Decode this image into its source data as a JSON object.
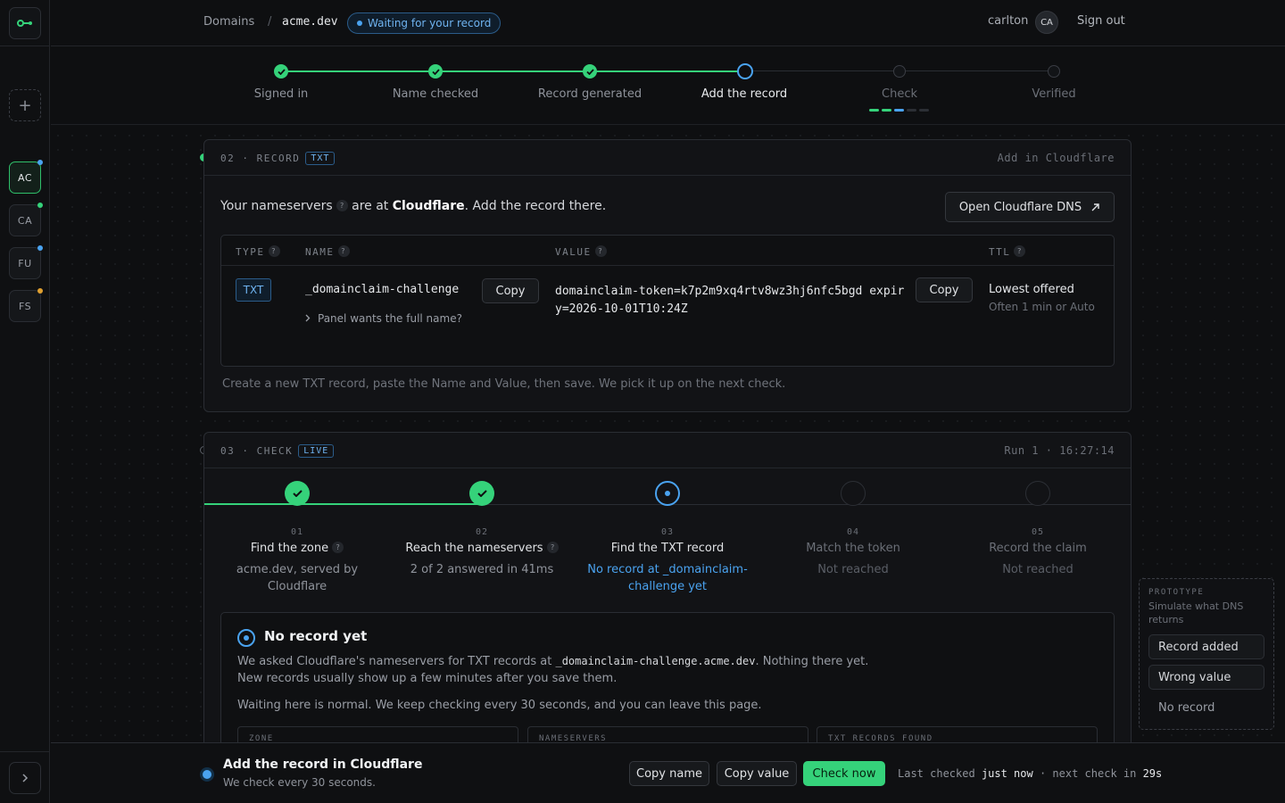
{
  "rail": {
    "workspaces": [
      {
        "label": "AC",
        "dot_color": "#4aa3f0"
      },
      {
        "label": "CA",
        "dot_color": "#35d27a"
      },
      {
        "label": "FU",
        "dot_color": "#4aa3f0"
      },
      {
        "label": "FS",
        "dot_color": "#e0a030"
      }
    ],
    "add_label": "+"
  },
  "header": {
    "crumb_root": "Domains",
    "crumb_sep": "/",
    "crumb_domain": "acme.dev",
    "status_badge": "Waiting for your record",
    "username": "carlton",
    "avatar": "CA",
    "signout": "Sign out"
  },
  "steps": [
    {
      "label": "Signed in",
      "state": "done"
    },
    {
      "label": "Name checked",
      "state": "done"
    },
    {
      "label": "Record generated",
      "state": "done"
    },
    {
      "label": "Add the record",
      "state": "current"
    },
    {
      "label": "Check",
      "state": "todo"
    },
    {
      "label": "Verified",
      "state": "todo"
    }
  ],
  "record": {
    "step_num": "02",
    "step_sep": "·",
    "step_name": "RECORD",
    "tag": "TXT",
    "right": "Add in Cloudflare",
    "intro_pre": "Your nameservers",
    "intro_mid": "are at",
    "intro_provider": "Cloudflare",
    "intro_post": ". Add the record there.",
    "open_dns_button": "Open Cloudflare DNS",
    "qm": "?",
    "columns": {
      "type": "TYPE",
      "name": "NAME",
      "value": "VALUE",
      "ttl": "TTL"
    },
    "type": "TXT",
    "name": "_domainclaim-challenge",
    "name_hint": "Panel wants the full name?",
    "value_line1": "domainclaim-token=k7p2m9xq4rtv8wz3hj6nfc5bgd expir",
    "value_line2": "y=2026-10-01T10:24Z",
    "copy": "Copy",
    "ttl_main": "Lowest offered",
    "ttl_sub": "Often 1 min or Auto",
    "footnote": "Create a new TXT record, paste the Name and Value, then save. We pick it up on the next check."
  },
  "check": {
    "step_num": "03",
    "step_sep": "·",
    "step_name": "CHECK",
    "tag": "LIVE",
    "run": "Run 1 · 16:27:14",
    "phases": [
      {
        "num": "01",
        "title": "Find the zone",
        "has_help": true,
        "sub": "acme.dev, served by Cloudflare",
        "state": "done"
      },
      {
        "num": "02",
        "title": "Reach the nameservers",
        "has_help": true,
        "sub": "2 of 2 answered in 41ms",
        "state": "done"
      },
      {
        "num": "03",
        "title": "Find the TXT record",
        "has_help": false,
        "sub": "No record at _domainclaim-challenge yet",
        "state": "current"
      },
      {
        "num": "04",
        "title": "Match the token",
        "has_help": false,
        "sub": "Not reached",
        "state": "todo"
      },
      {
        "num": "05",
        "title": "Record the claim",
        "has_help": false,
        "sub": "Not reached",
        "state": "todo"
      }
    ],
    "result_title": "No record yet",
    "result_p1_pre": "We asked Cloudflare's nameservers for TXT records at ",
    "result_p1_code": "_domainclaim-challenge.acme.dev",
    "result_p1_post": ". Nothing there yet.",
    "result_p2": "New records usually show up a few minutes after you save them.",
    "result_p3": "Waiting here is normal. We keep checking every 30 seconds, and you can leave this page.",
    "mini_cols": [
      "ZONE",
      "NAMESERVERS",
      "TXT RECORDS FOUND"
    ]
  },
  "prototype": {
    "tag": "PROTOTYPE",
    "desc": "Simulate what DNS returns",
    "options": [
      "Record added",
      "Wrong value",
      "No record"
    ]
  },
  "bottom": {
    "title": "Add the record in Cloudflare",
    "sub": "We check every 30 seconds.",
    "copy_name": "Copy name",
    "copy_value": "Copy value",
    "check_now": "Check now",
    "status_pre": "Last checked",
    "status_when": "just now",
    "status_mid": "· next check in",
    "status_next": "29s"
  },
  "colors": {
    "accent_green": "#35d27a",
    "accent_blue": "#4aa3f0",
    "background": "#0e0f11"
  }
}
